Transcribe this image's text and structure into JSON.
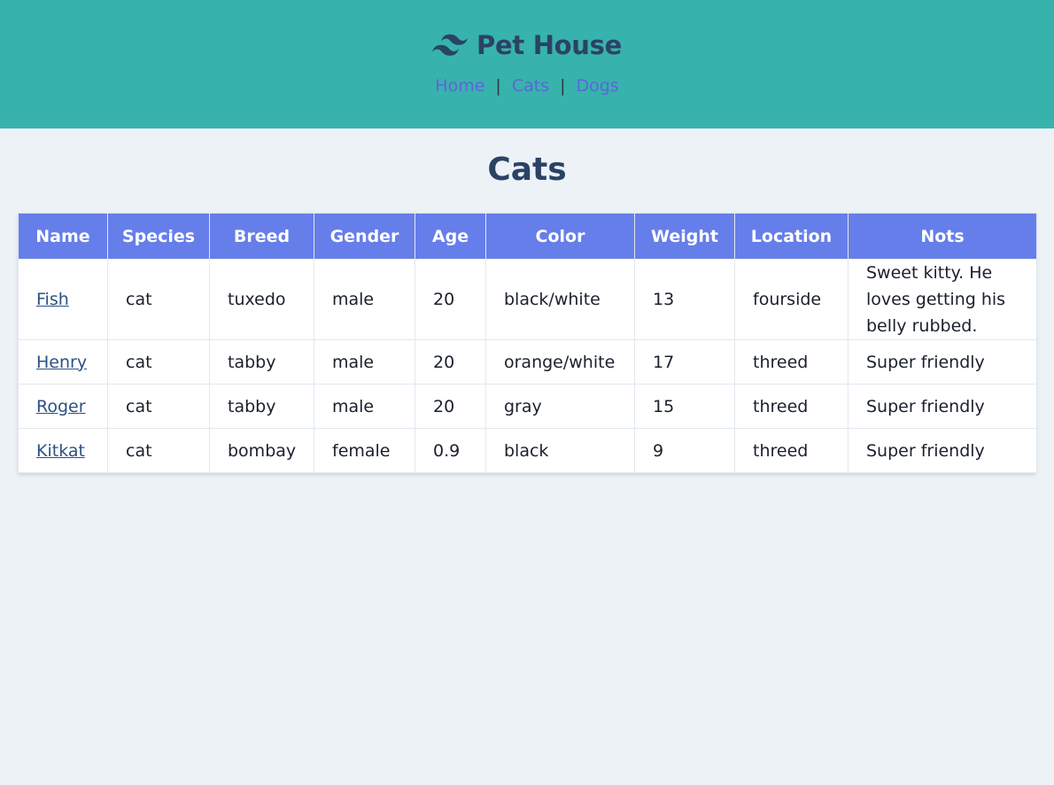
{
  "header": {
    "title": "Pet House",
    "logo_icon": "tailwind-wave-icon",
    "nav": [
      {
        "label": "Home"
      },
      {
        "label": "Cats"
      },
      {
        "label": "Dogs"
      }
    ],
    "separator": "|"
  },
  "main": {
    "title": "Cats",
    "table": {
      "columns": [
        "Name",
        "Species",
        "Breed",
        "Gender",
        "Age",
        "Color",
        "Weight",
        "Location",
        "Nots"
      ],
      "rows": [
        {
          "name": "Fish",
          "species": "cat",
          "breed": "tuxedo",
          "gender": "male",
          "age": "20",
          "color": "black/white",
          "weight": "13",
          "location": "fourside",
          "notes": "Sweet kitty. He loves getting his belly rubbed."
        },
        {
          "name": "Henry",
          "species": "cat",
          "breed": "tabby",
          "gender": "male",
          "age": "20",
          "color": "orange/white",
          "weight": "17",
          "location": "threed",
          "notes": "Super friendly"
        },
        {
          "name": "Roger",
          "species": "cat",
          "breed": "tabby",
          "gender": "male",
          "age": "20",
          "color": "gray",
          "weight": "15",
          "location": "threed",
          "notes": "Super friendly"
        },
        {
          "name": "Kitkat",
          "species": "cat",
          "breed": "bombay",
          "gender": "female",
          "age": "0.9",
          "color": "black",
          "weight": "9",
          "location": "threed",
          "notes": "Super friendly"
        }
      ]
    }
  },
  "colors": {
    "header_bg": "#38b2ac",
    "table_header_bg": "#667eea",
    "title_text": "#2a4365",
    "nav_link": "#5a67d8",
    "page_bg": "#edf2f7"
  }
}
